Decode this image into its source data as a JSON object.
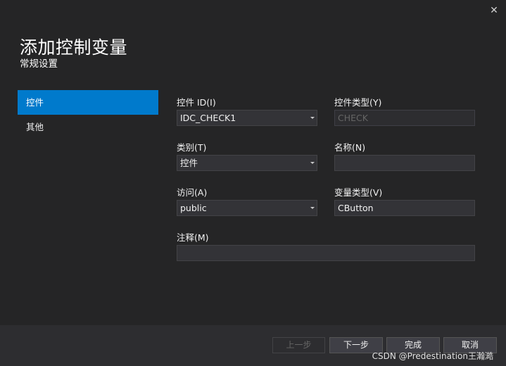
{
  "dialog": {
    "title": "添加控制变量",
    "subtitle": "常规设置",
    "close_icon": "✕"
  },
  "nav": {
    "items": [
      {
        "label": "控件",
        "active": true
      },
      {
        "label": "其他",
        "active": false
      }
    ]
  },
  "form": {
    "control_id": {
      "label": "控件 ID(I)",
      "value": "IDC_CHECK1"
    },
    "control_type": {
      "label": "控件类型(Y)",
      "value": "CHECK"
    },
    "category": {
      "label": "类别(T)",
      "value": "控件"
    },
    "name": {
      "label": "名称(N)",
      "value": ""
    },
    "access": {
      "label": "访问(A)",
      "value": "public"
    },
    "variable_type": {
      "label": "变量类型(V)",
      "value": "CButton"
    },
    "comment": {
      "label": "注释(M)",
      "value": ""
    }
  },
  "footer": {
    "prev_label": "上一步",
    "next_label": "下一步",
    "finish_label": "完成",
    "cancel_label": "取消"
  },
  "watermark": "CSDN @Predestination王瀚澔"
}
